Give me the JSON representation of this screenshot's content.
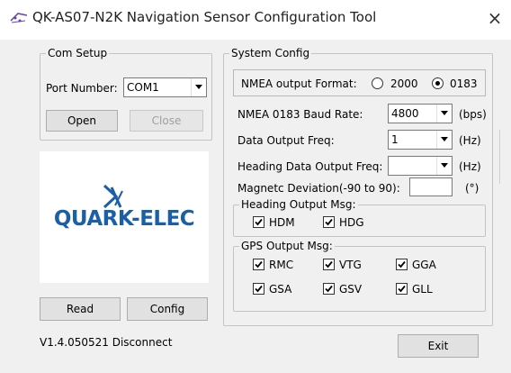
{
  "window": {
    "title": "QK-AS07-N2K Navigation Sensor Configuration Tool",
    "close_glyph": "×"
  },
  "com_setup": {
    "legend": "Com Setup",
    "port_label": "Port Number:",
    "port_value": "COM1",
    "open_label": "Open",
    "close_label": "Close"
  },
  "logo": {
    "text": "QUARK-ELEC",
    "color": "#1a5fa8"
  },
  "actions": {
    "read_label": "Read",
    "config_label": "Config",
    "exit_label": "Exit"
  },
  "status": {
    "version_text": "V1.4.050521 Disconnect"
  },
  "system_config": {
    "legend": "System Config",
    "nmea_format_label": "NMEA output Format:",
    "format_options": [
      {
        "label": "2000",
        "selected": false
      },
      {
        "label": "0183",
        "selected": true
      }
    ],
    "baud_label": "NMEA 0183 Baud Rate:",
    "baud_value": "4800",
    "baud_unit": "(bps)",
    "freq_label": "Data Output Freq:",
    "freq_value": "1",
    "freq_unit": "(Hz)",
    "heading_freq_label": "Heading Data Output Freq:",
    "heading_freq_value": "",
    "heading_freq_unit": "(Hz)",
    "deviation_label": "Magnetc Deviation(-90 to 90):",
    "deviation_value": "",
    "deviation_unit": "(°)"
  },
  "heading_output": {
    "legend": "Heading Output Msg:",
    "items": [
      {
        "label": "HDM",
        "checked": true
      },
      {
        "label": "HDG",
        "checked": true
      }
    ]
  },
  "gps_output": {
    "legend": "GPS Output Msg:",
    "items": [
      {
        "label": "RMC",
        "checked": true
      },
      {
        "label": "VTG",
        "checked": true
      },
      {
        "label": "GGA",
        "checked": true
      },
      {
        "label": "GSA",
        "checked": true
      },
      {
        "label": "GSV",
        "checked": true
      },
      {
        "label": "GLL",
        "checked": true
      }
    ]
  }
}
